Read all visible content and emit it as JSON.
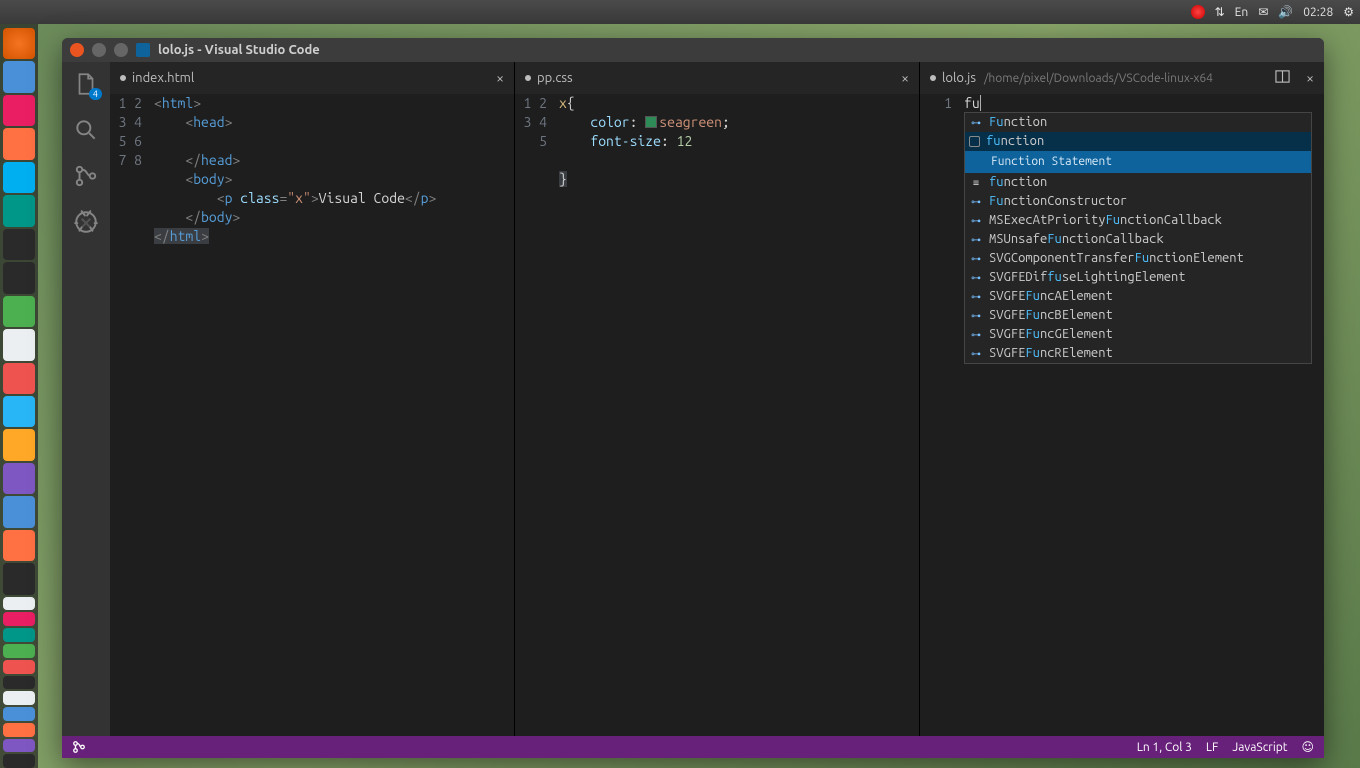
{
  "top_panel": {
    "time": "02:28",
    "lang": "En"
  },
  "launcher_icons": [
    "ubuntu",
    "blue",
    "pink",
    "orange",
    "sky",
    "teal",
    "dark",
    "dark",
    "green",
    "white",
    "red",
    "tg",
    "yellow",
    "purple",
    "blue",
    "orange",
    "dark",
    "white",
    "pink",
    "teal",
    "green",
    "red",
    "dark",
    "white",
    "blue",
    "orange",
    "purple",
    "dark"
  ],
  "window": {
    "title": "lolo.js - Visual Studio Code",
    "activitybar_badge": "4",
    "statusbar": {
      "position": "Ln 1, Col 3",
      "eol": "LF",
      "language": "JavaScript"
    }
  },
  "tabs": [
    {
      "name": "index.html",
      "modified": true
    },
    {
      "name": "pp.css",
      "modified": true
    },
    {
      "name": "lolo.js",
      "modified": true,
      "path": "/home/pixel/Downloads/VSCode-linux-x64"
    }
  ],
  "pane1_lines": [
    "1",
    "2",
    "3",
    "4",
    "5",
    "6",
    "7",
    "8"
  ],
  "pane2_lines": [
    "1",
    "2",
    "3",
    "4",
    "5"
  ],
  "pane3_lines": [
    "1"
  ],
  "code": {
    "html": {
      "l1_a": "<",
      "l1_b": "html",
      "l1_c": ">",
      "l2_a": "    <",
      "l2_b": "head",
      "l2_c": ">",
      "l4_a": "    </",
      "l4_b": "head",
      "l4_c": ">",
      "l5_a": "    <",
      "l5_b": "body",
      "l5_c": ">",
      "l6_a": "        <",
      "l6_b": "p",
      "l6_sp": " ",
      "l6_c": "class",
      "l6_d": "=",
      "l6_e": "\"x\"",
      "l6_f": ">",
      "l6_g": "Visual Code",
      "l6_h": "</",
      "l6_i": "p",
      "l6_j": ">",
      "l7_a": "    </",
      "l7_b": "body",
      "l7_c": ">",
      "l8_a": "</",
      "l8_b": "html",
      "l8_c": ">"
    },
    "css": {
      "l1_a": "x",
      "l1_b": "{",
      "l2_a": "    ",
      "l2_b": "color",
      "l2_c": ": ",
      "l2_d": "seagreen",
      "l2_e": ";",
      "l3_a": "    ",
      "l3_b": "font-size",
      "l3_c": ": ",
      "l3_d": "12",
      "l5_a": "}"
    },
    "js": {
      "l1": "fu"
    }
  },
  "suggest": {
    "detail": "Function Statement",
    "items": [
      {
        "kind": "key",
        "pre": "Fu",
        "post": "nction"
      },
      {
        "kind": "snip",
        "pre": "fu",
        "post": "nction",
        "selected": true
      },
      {
        "kind": "enum",
        "pre": "fu",
        "post": "nction"
      },
      {
        "kind": "key",
        "pre": "Fu",
        "post": "nctionConstructor"
      },
      {
        "kind": "key",
        "pre0": "MSExecAtPriority",
        "pre": "Fu",
        "post": "nctionCallback"
      },
      {
        "kind": "key",
        "pre0": "MSUnsafe",
        "pre": "Fu",
        "post": "nctionCallback"
      },
      {
        "kind": "key",
        "pre0": "SVGComponentTransfer",
        "pre": "Fu",
        "post": "nctionElement"
      },
      {
        "kind": "key",
        "pre0": "SVGFEDif",
        "pre": "fu",
        "post": "seLightingElement"
      },
      {
        "kind": "key",
        "pre0": "SVGFE",
        "pre": "Fu",
        "post": "ncAElement"
      },
      {
        "kind": "key",
        "pre0": "SVGFE",
        "pre": "Fu",
        "post": "ncBElement"
      },
      {
        "kind": "key",
        "pre0": "SVGFE",
        "pre": "Fu",
        "post": "ncGElement"
      },
      {
        "kind": "key",
        "pre0": "SVGFE",
        "pre": "Fu",
        "post": "ncRElement"
      }
    ]
  }
}
